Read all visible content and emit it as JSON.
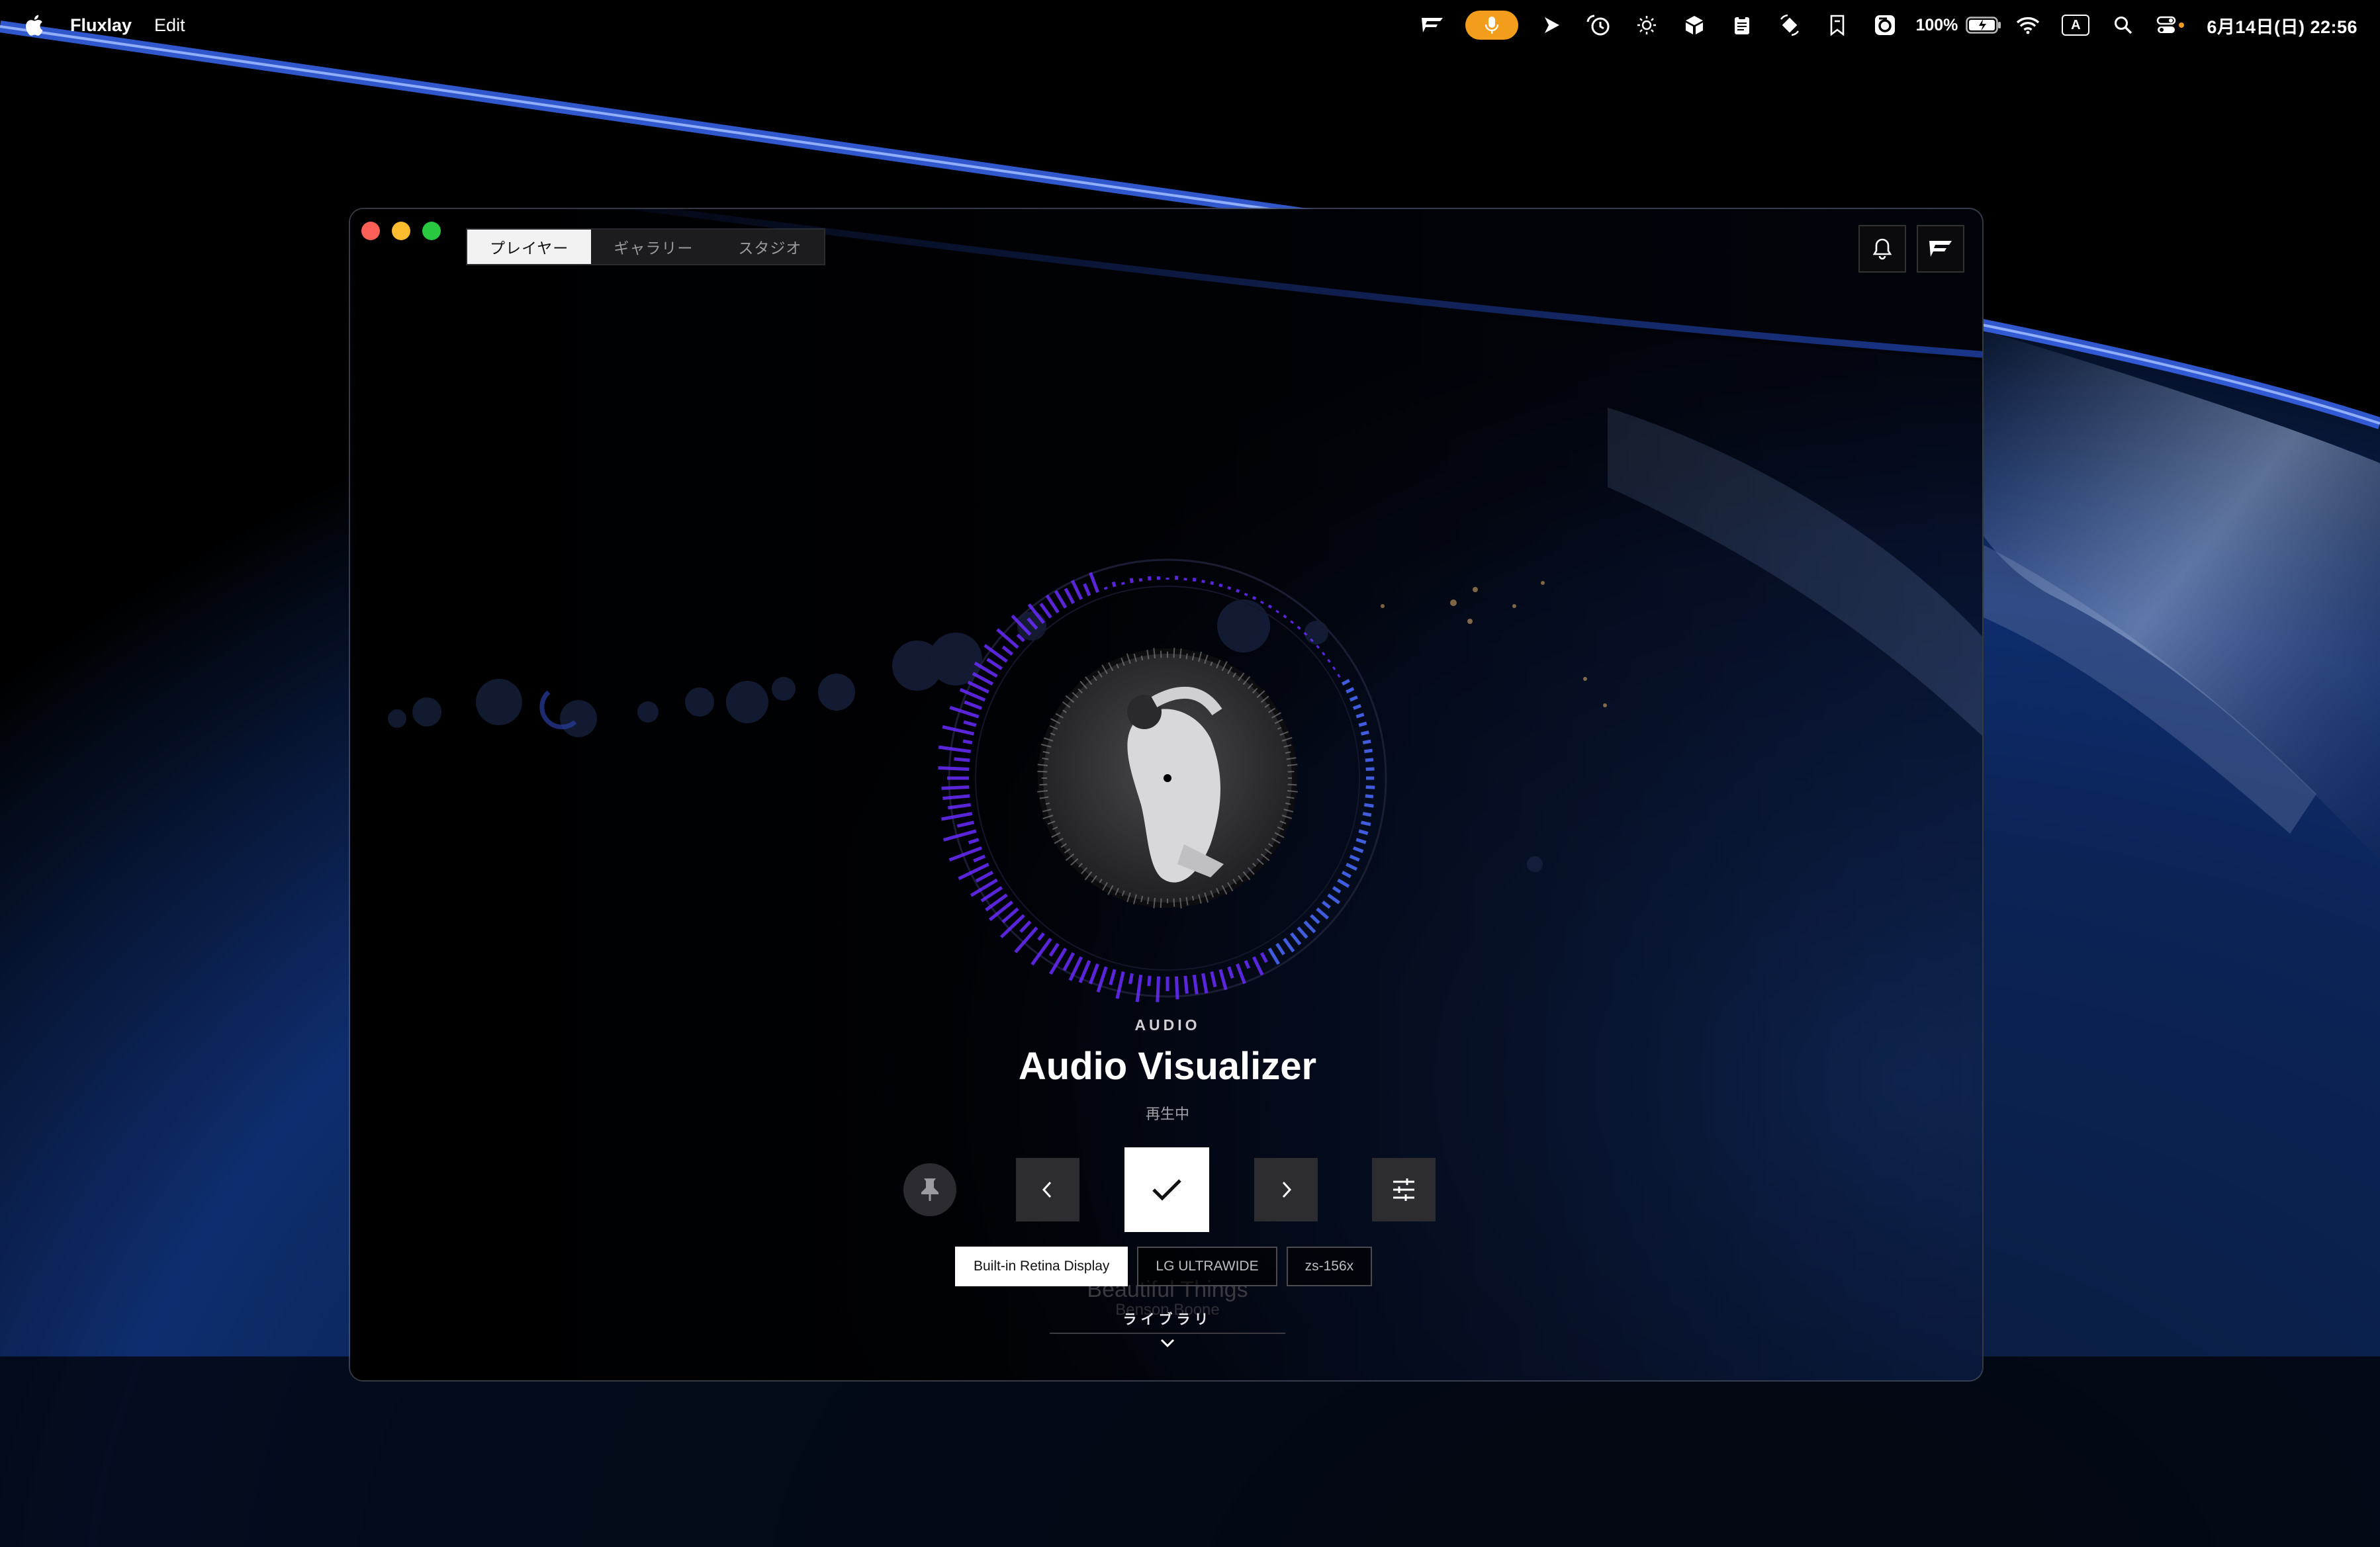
{
  "menubar": {
    "app_name": "Fluxlay",
    "menu_edit": "Edit",
    "battery_percent": "100%",
    "keyboard_input": "A",
    "clock": "6月14日(日) 22:56"
  },
  "window": {
    "tabs": [
      {
        "label": "プレイヤー",
        "active": true
      },
      {
        "label": "ギャラリー",
        "active": false
      },
      {
        "label": "スタジオ",
        "active": false
      }
    ]
  },
  "player": {
    "category": "AUDIO",
    "title": "Audio Visualizer",
    "status": "再生中",
    "displays": [
      {
        "label": "Built-in Retina Display",
        "active": true
      },
      {
        "label": "LG ULTRAWIDE",
        "active": false
      },
      {
        "label": "zs-156x",
        "active": false
      }
    ],
    "background_item_title": "Beautiful Things",
    "background_item_subtitle": "Benson Boone",
    "library_label": "ライブラリ"
  },
  "icons": [
    "apple-icon",
    "flag-icon",
    "microphone-icon",
    "play-arrow-icon",
    "timer-icon",
    "brightness-icon",
    "cube-icon",
    "clipboard-icon",
    "rotate-icon",
    "bookmark-icon",
    "app-icon",
    "battery-icon",
    "wifi-icon",
    "input-source-icon",
    "search-icon",
    "control-center-icon",
    "bell-icon",
    "logo-icon",
    "pin-icon",
    "chevron-left-icon",
    "check-icon",
    "chevron-right-icon",
    "sliders-icon",
    "chevron-down-icon"
  ],
  "colors": {
    "accent_mic": "#f29d1b",
    "spectrum_purple": "#6a2cff",
    "spectrum_blue": "#4a6cff",
    "traffic_close": "#fe5f57",
    "traffic_minimize": "#febc2e",
    "traffic_maximize": "#28c840"
  }
}
